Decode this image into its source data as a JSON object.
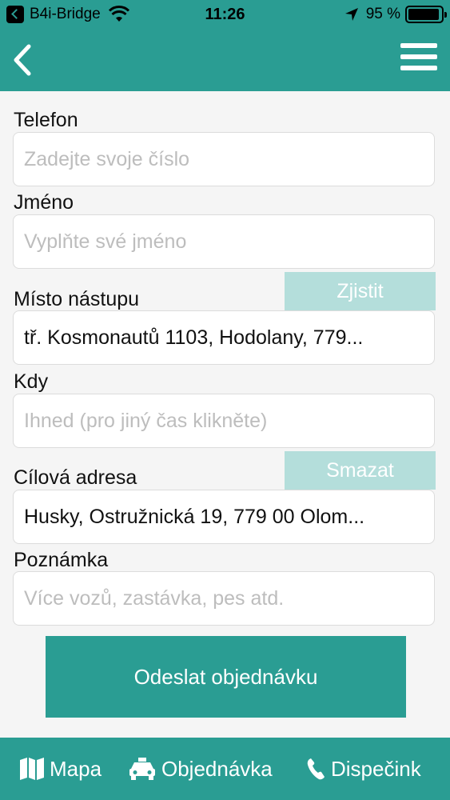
{
  "status_bar": {
    "carrier": "B4i-Bridge",
    "time": "11:26",
    "battery_text": "95 %",
    "battery_level": 0.95
  },
  "nav": {
    "back_icon": "chevron-left-icon",
    "menu_icon": "hamburger-menu-icon"
  },
  "form": {
    "phone": {
      "label": "Telefon",
      "placeholder": "Zadejte svoje číslo"
    },
    "name": {
      "label": "Jméno",
      "placeholder": "Vyplňte své jméno"
    },
    "pickup": {
      "label": "Místo nástupu",
      "value": "tř. Kosmonautů 1103, Hodolany, 779...",
      "action_label": "Zjistit"
    },
    "when": {
      "label": "Kdy",
      "placeholder": "Ihned (pro jiný čas klikněte)"
    },
    "destination": {
      "label": "Cílová adresa",
      "value": "Husky, Ostružnická 19, 779 00 Olom...",
      "action_label": "Smazat"
    },
    "note": {
      "label": "Poznámka",
      "placeholder": "Více vozů, zastávka, pes atd."
    },
    "submit_label": "Odeslat objednávku"
  },
  "tabs": [
    {
      "label": "Mapa",
      "icon": "map-icon"
    },
    {
      "label": "Objednávka",
      "icon": "taxi-icon"
    },
    {
      "label": "Dispečink",
      "icon": "phone-icon"
    }
  ],
  "colors": {
    "accent": "#2a9d93",
    "aux_button": "#b4dedb",
    "background": "#f5f5f5"
  }
}
